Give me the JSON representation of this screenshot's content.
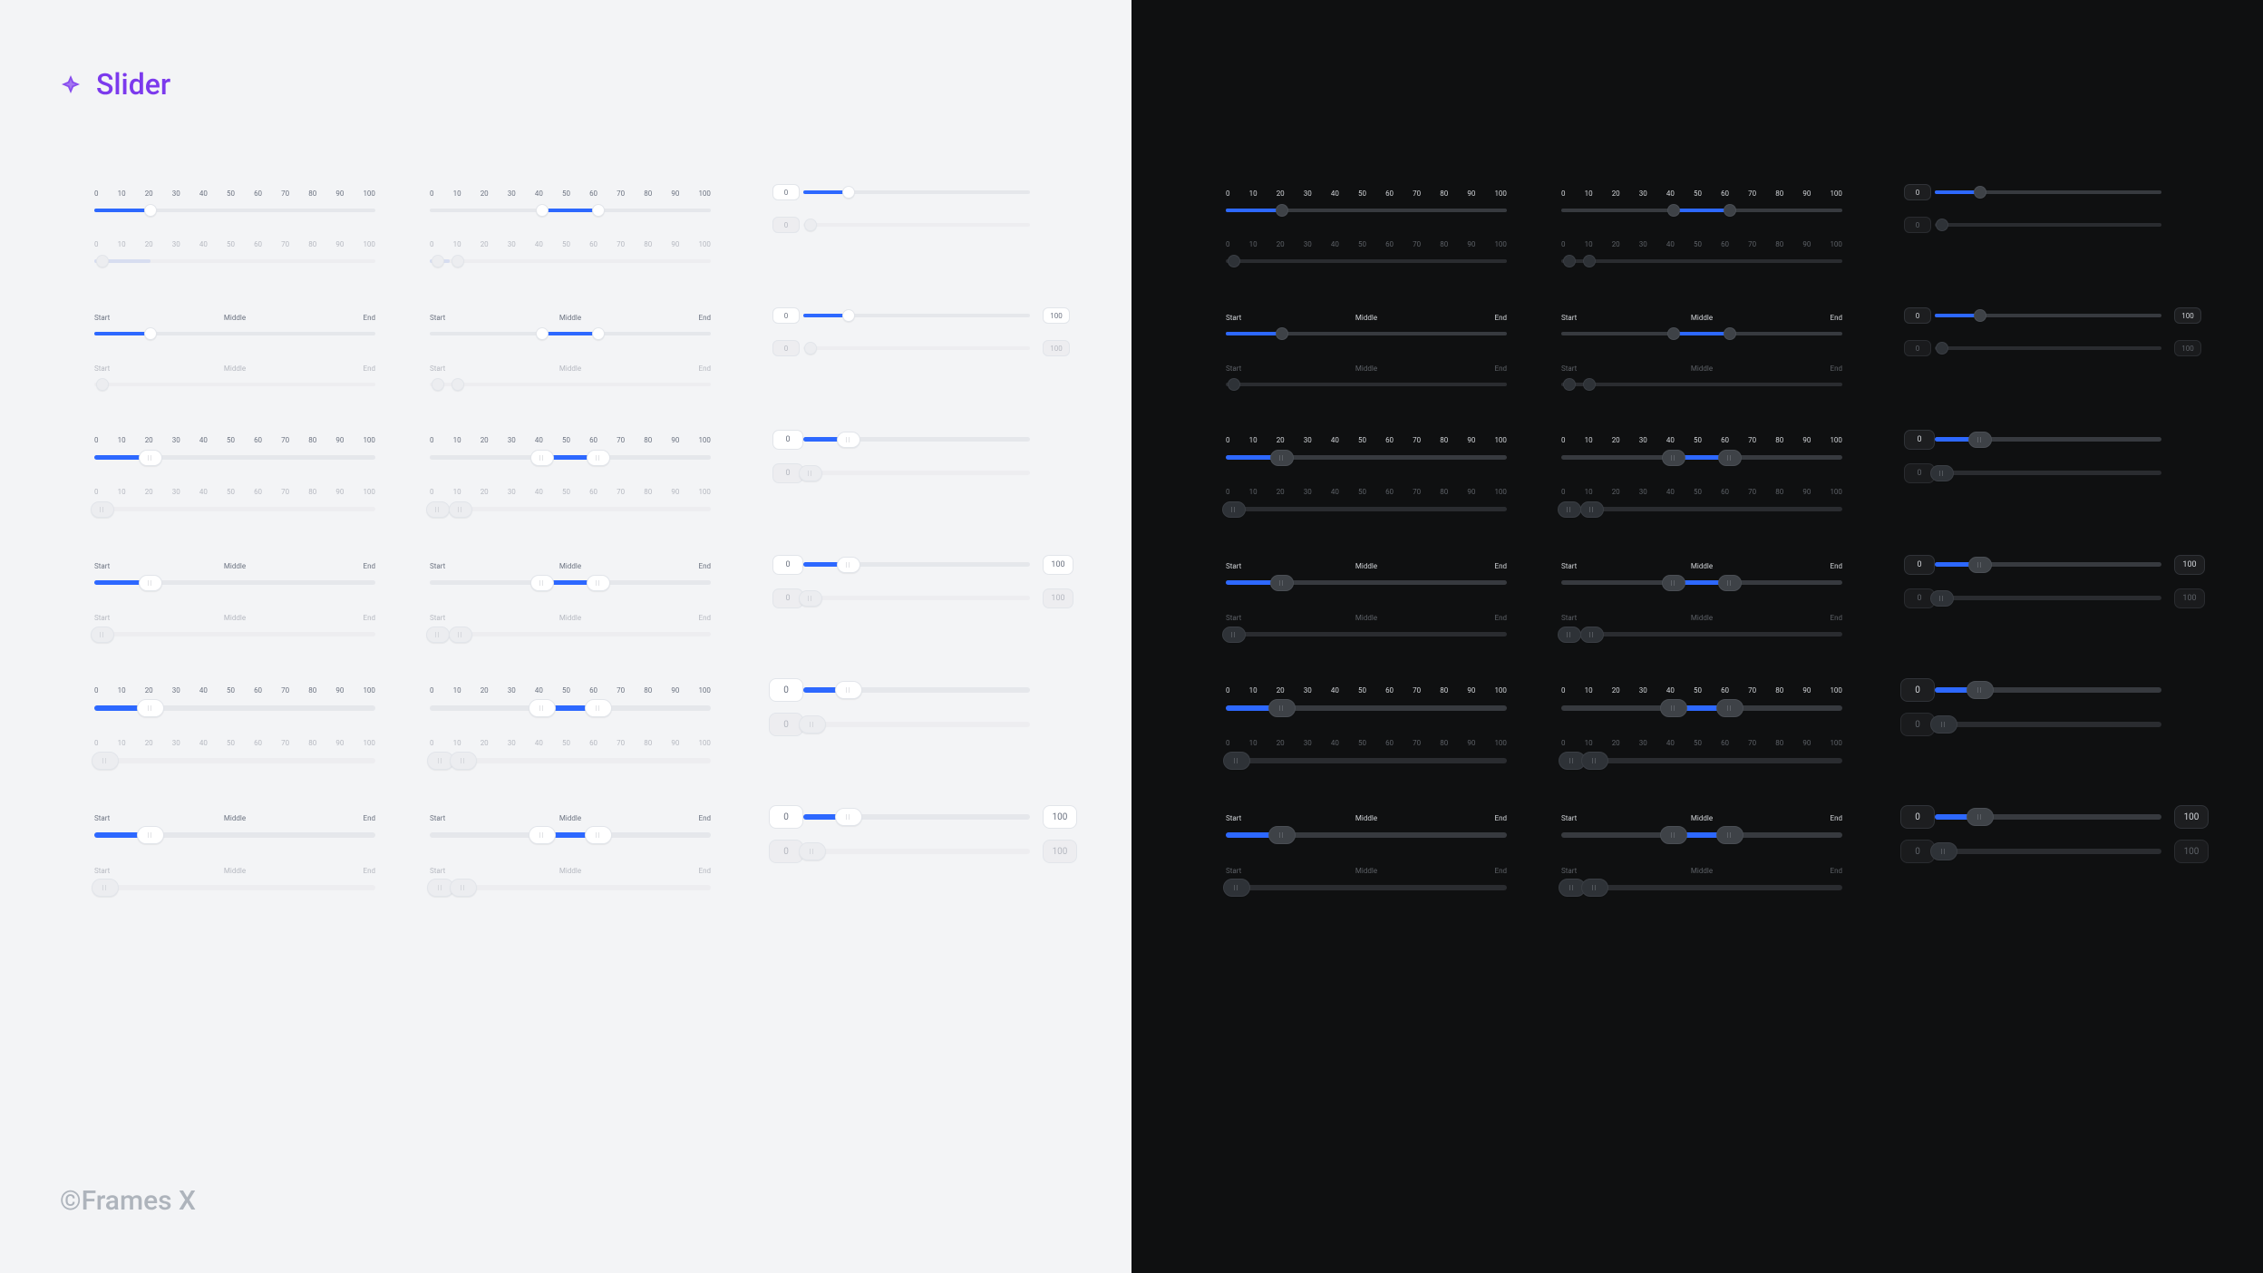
{
  "title": "Slider",
  "footer": "©Frames X",
  "scale": {
    "ticks": [
      "0",
      "10",
      "20",
      "30",
      "40",
      "50",
      "60",
      "70",
      "80",
      "90",
      "100"
    ]
  },
  "labels": {
    "start": "Start",
    "middle": "Middle",
    "end": "End"
  },
  "badges": {
    "zero": "0",
    "hundred": "100"
  },
  "variants": {
    "single": {
      "value": 20
    },
    "range": {
      "from": 40,
      "to": 60
    },
    "withEnd": {
      "value": 20,
      "end": 100
    }
  }
}
